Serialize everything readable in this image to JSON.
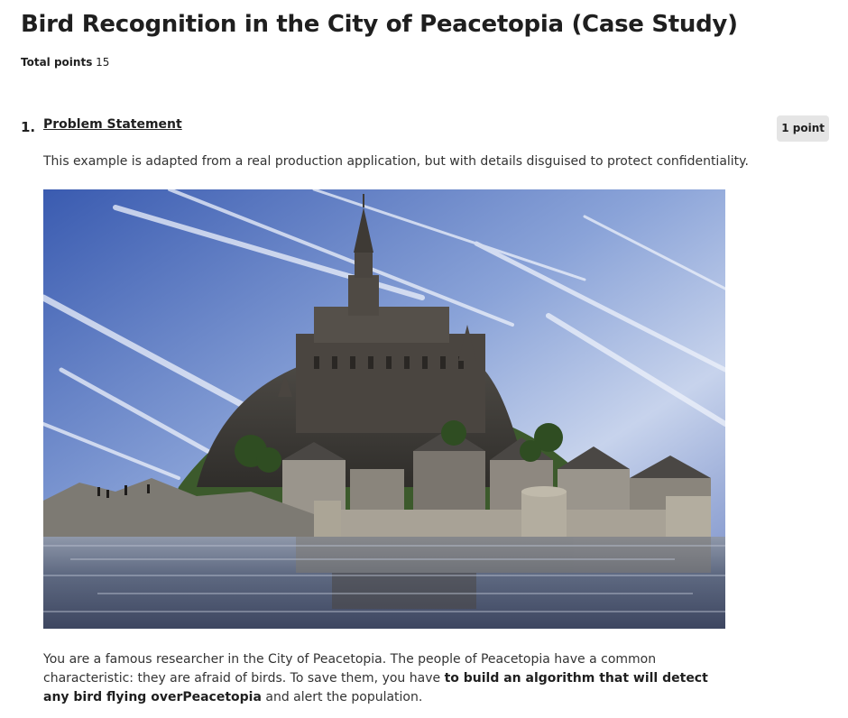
{
  "page": {
    "title": "Bird Recognition in the City of Peacetopia (Case Study)",
    "total_points_label": "Total points",
    "total_points_value": "15"
  },
  "question": {
    "number": "1.",
    "title": "Problem Statement",
    "points": "1 point",
    "intro": "This example is adapted from a real production application, but with details disguised to protect confidentiality.",
    "image_subject": "castle-island-reflection-photo",
    "body_part1": "You are a famous researcher in the City of Peacetopia. The people of Peacetopia have a common characteristic: they are afraid of birds. To save them, you have ",
    "body_bold": "to build an algorithm that will detect any bird flying overPeacetopia",
    "body_part2": " and alert the population."
  },
  "colors": {
    "badge_bg": "#e5e5e5",
    "text": "#1f1f1f",
    "sky_top": "#2f4fa3",
    "sky_light": "#c9d6ee",
    "stone": "#5a5550",
    "water": "#6a7690"
  }
}
